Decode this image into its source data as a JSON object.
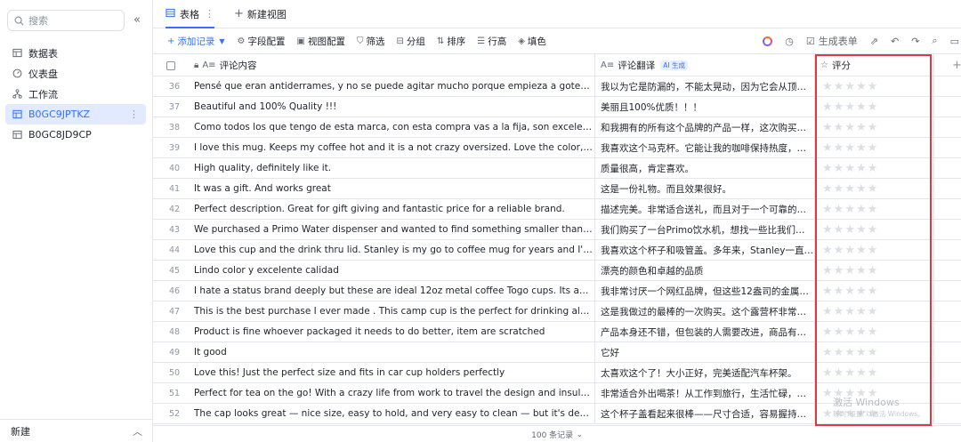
{
  "sidebar": {
    "search_placeholder": "搜索",
    "items": [
      {
        "label": "数据表",
        "icon": "table-icon",
        "active": false
      },
      {
        "label": "仪表盘",
        "icon": "dashboard-icon",
        "active": false
      },
      {
        "label": "工作流",
        "icon": "workflow-icon",
        "active": false
      },
      {
        "label": "B0GC9JPTKZ",
        "icon": "table-icon",
        "active": true
      },
      {
        "label": "B0GC8JD9CP",
        "icon": "table-icon",
        "active": false
      }
    ],
    "footer_label": "新建"
  },
  "viewbar": {
    "active_tab": "表格",
    "new_view": "新建视图"
  },
  "toolbar": {
    "add_record": "添加记录",
    "field_config": "字段配置",
    "view_config": "视图配置",
    "filter": "筛选",
    "group": "分组",
    "sort": "排序",
    "row_height": "行高",
    "fill": "填色",
    "generate_form": "生成表单"
  },
  "table": {
    "columns": {
      "comment": "评论内容",
      "translation": "评论翻译",
      "ai_badge": "AI 生成",
      "rating": "评分"
    },
    "rows": [
      {
        "n": "36",
        "comment": "Pensé que eran antiderrames, y no se puede agitar mucho porque empieza a gotear por la parte s...",
        "translation": "我以为它是防漏的，不能太晃动，因为它会从顶部...",
        "rating": 0
      },
      {
        "n": "37",
        "comment": "Beautiful and 100% Quality !!!",
        "translation": "美丽且100%优质！！！",
        "rating": 0
      },
      {
        "n": "38",
        "comment": "Como todos los que tengo de esta marca, con esta compra vas a la fija, son excelentes",
        "translation": "和我拥有的所有这个品牌的产品一样，这次购买你...",
        "rating": 0
      },
      {
        "n": "39",
        "comment": "I love this mug. Keeps my coffee hot and it is a not crazy oversized. Love the color, lightweight an...",
        "translation": "我喜欢这个马克杯。它能让我的咖啡保持热度，而...",
        "rating": 0
      },
      {
        "n": "40",
        "comment": "High quality, definitely like it.",
        "translation": "质量很高，肯定喜欢。",
        "rating": 0
      },
      {
        "n": "41",
        "comment": "It was a gift. And works great",
        "translation": "这是一份礼物。而且效果很好。",
        "rating": 0
      },
      {
        "n": "42",
        "comment": "Perfect description. Great for gift giving and fantastic price for a reliable brand.",
        "translation": "描述完美。非常适合送礼，而且对于一个可靠的品...",
        "rating": 0
      },
      {
        "n": "43",
        "comment": "We purchased a Primo Water dispenser and wanted to find something smaller than our larger tu...",
        "translation": "我们购买了一台Primo饮水机，想找一些比我们的大...",
        "rating": 0
      },
      {
        "n": "44",
        "comment": "Love this cup and the drink thru lid. Stanley is my go to coffee mug for years and I'm thrilled they...",
        "translation": "我喜欢这个杯子和吸管盖。多年来，Stanley一直是...",
        "rating": 0
      },
      {
        "n": "45",
        "comment": "Lindo color y excelente calidad",
        "translation": "漂亮的颜色和卓越的品质",
        "rating": 0
      },
      {
        "n": "46",
        "comment": "I hate a status brand deeply but these are ideal 12oz metal coffee Togo cups. Its annoying but tr...",
        "translation": "我非常讨厌一个网红品牌，但这些12盎司的金属咖...",
        "rating": 0
      },
      {
        "n": "47",
        "comment": "This is the best purchase I ever made . This camp cup is the perfect for drinking alcoholic bevera...",
        "translation": "这是我做过的最棒的一次购买。这个露营杯非常适...",
        "rating": 0
      },
      {
        "n": "48",
        "comment": "Product is fine whoever packaged it needs to do better, item are scratched",
        "translation": "产品本身还不错，但包装的人需要改进，商品有划...",
        "rating": 0
      },
      {
        "n": "49",
        "comment": "It good",
        "translation": "它好",
        "rating": 0
      },
      {
        "n": "50",
        "comment": "Love this! Just the perfect size and fits in car cup holders perfectly",
        "translation": "太喜欢这个了！大小正好，完美适配汽车杯架。",
        "rating": 0
      },
      {
        "n": "51",
        "comment": "Perfect for tea on the go! With a crazy life from work to travel the design and insulation have bee...",
        "translation": "非常适合外出喝茶！从工作到旅行，生活忙碌，其...",
        "rating": 0
      },
      {
        "n": "52",
        "comment": "The cap looks great — nice size, easy to hold, and very easy to clean — but it's definitely NOT lea...",
        "translation": "这个杯子盖看起来很棒——尺寸合适，容易握持，也...",
        "rating": 0
      }
    ],
    "record_count": "100 条记录"
  },
  "watermark": {
    "title": "激活 Windows",
    "subtitle": "转到\"设置\"以激活 Windows。"
  },
  "colors": {
    "accent": "#3370ff",
    "highlight_border": "#e0383e",
    "star_empty": "#dcdfe4"
  }
}
